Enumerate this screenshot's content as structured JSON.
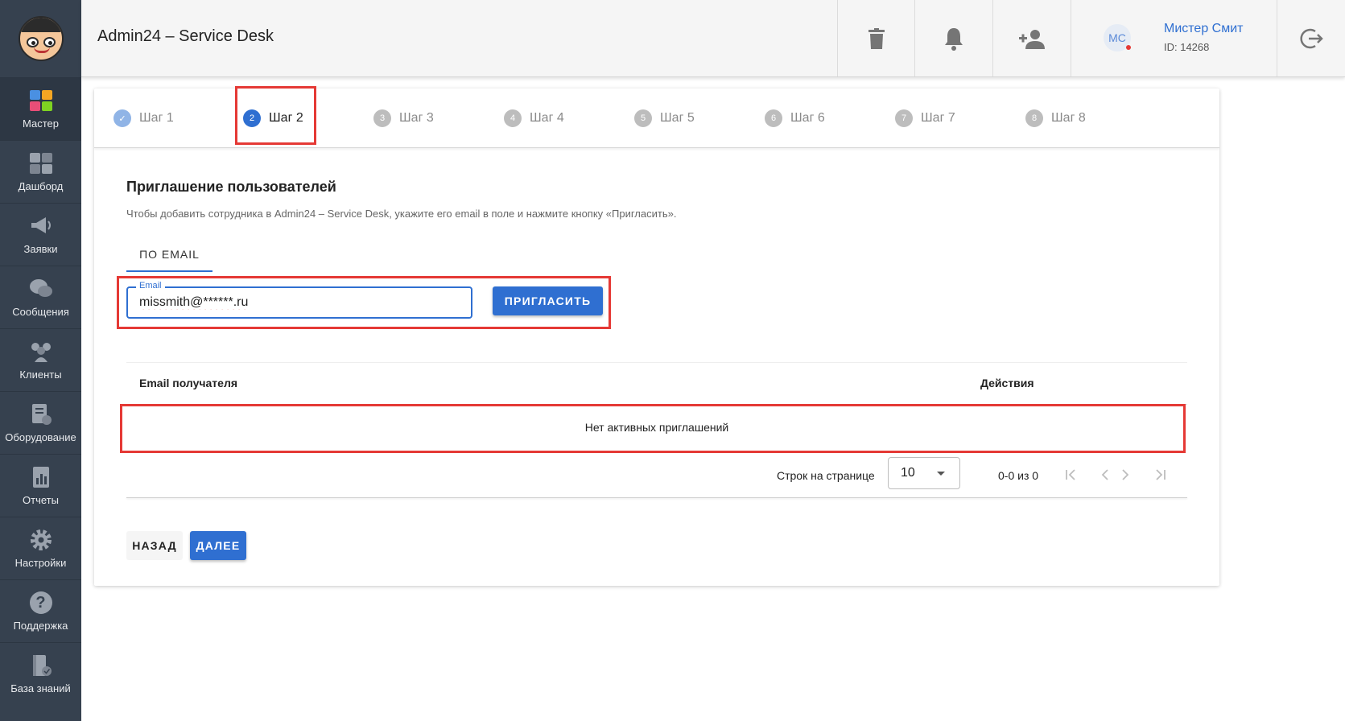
{
  "app": {
    "title": "Admin24 – Service Desk"
  },
  "sidebar": {
    "items": [
      {
        "label": "Мастер",
        "icon": "wizard-icon"
      },
      {
        "label": "Дашборд",
        "icon": "dashboard-icon"
      },
      {
        "label": "Заявки",
        "icon": "megaphone-icon"
      },
      {
        "label": "Сообщения",
        "icon": "chat-icon"
      },
      {
        "label": "Клиенты",
        "icon": "clients-icon"
      },
      {
        "label": "Оборудование",
        "icon": "equipment-icon"
      },
      {
        "label": "Отчеты",
        "icon": "reports-icon"
      },
      {
        "label": "Настройки",
        "icon": "gear-icon"
      },
      {
        "label": "Поддержка",
        "icon": "help-icon"
      },
      {
        "label": "База знаний",
        "icon": "knowledge-base-icon"
      }
    ],
    "help_glyph": "?"
  },
  "header": {
    "user": {
      "initials": "МС",
      "name": "Мистер Смит",
      "id": "ID: 14268"
    }
  },
  "stepper": {
    "steps": [
      {
        "num": "✓",
        "label": "Шаг 1",
        "state": "done"
      },
      {
        "num": "2",
        "label": "Шаг 2",
        "state": "active"
      },
      {
        "num": "3",
        "label": "Шаг 3",
        "state": "pending"
      },
      {
        "num": "4",
        "label": "Шаг 4",
        "state": "pending"
      },
      {
        "num": "5",
        "label": "Шаг 5",
        "state": "pending"
      },
      {
        "num": "6",
        "label": "Шаг 6",
        "state": "pending"
      },
      {
        "num": "7",
        "label": "Шаг 7",
        "state": "pending"
      },
      {
        "num": "8",
        "label": "Шаг 8",
        "state": "pending"
      }
    ]
  },
  "invite": {
    "title": "Приглашение пользователей",
    "description": "Чтобы добавить сотрудника в Admin24 – Service Desk, укажите его email в поле и нажмите кнопку «Пригласить».",
    "tab_label": "ПО EMAIL",
    "email_label": "Email",
    "email_value": "missmith@******.ru",
    "invite_button": "ПРИГЛАСИТЬ"
  },
  "table": {
    "col_email": "Email получателя",
    "col_actions": "Действия",
    "empty_message": "Нет активных приглашений",
    "rows_per_page_label": "Строк на странице",
    "rows_per_page": "10",
    "range": "0-0 из 0"
  },
  "footer": {
    "back_button": "НАЗАД",
    "next_button": "ДАЛЕЕ"
  },
  "colors": {
    "accent": "#2f6fd1",
    "sidebar_bg": "#36414f",
    "highlight": "#e53935"
  }
}
